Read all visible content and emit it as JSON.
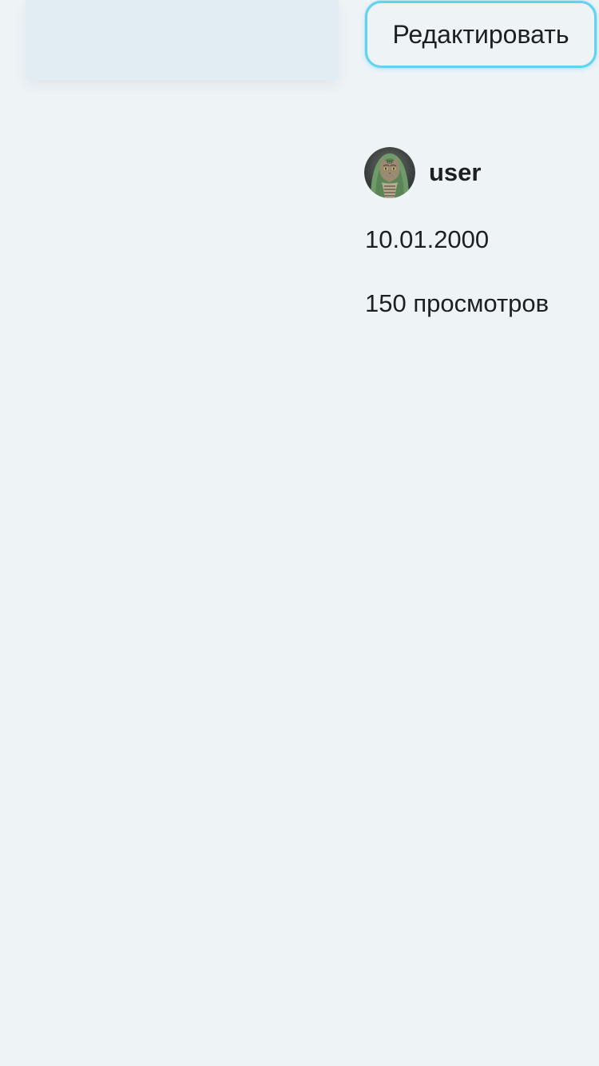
{
  "article": {
    "edit_label": "Редактировать",
    "author": {
      "username": "user",
      "avatar": "cat-avatar"
    },
    "date": "10.01.2000",
    "views": "150 просмотров"
  },
  "colors": {
    "background": "#eef3f6",
    "card": "#e1edf2",
    "accent": "#63d2ef",
    "text": "#1c1f23"
  }
}
